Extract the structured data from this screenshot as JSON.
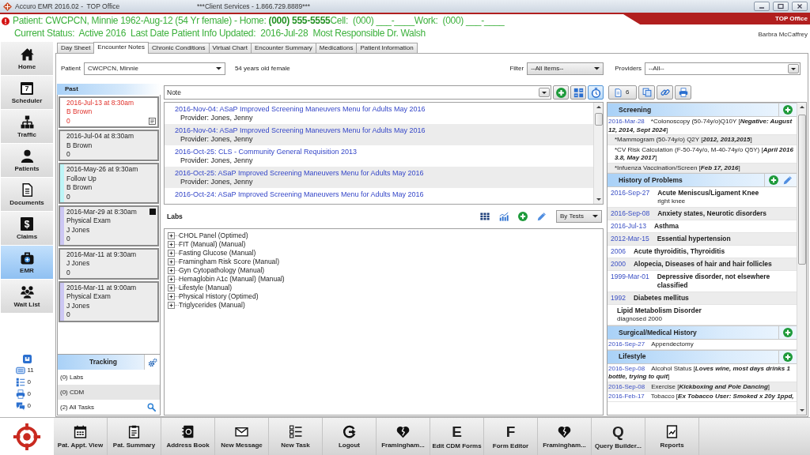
{
  "window": {
    "title": "Accuro EMR 2016.02 -  TOP Office",
    "banner": "***Client Services - 1.866.729.8889***"
  },
  "header": {
    "office": "TOP Office",
    "patient_line": "Patient: CWCPCN, Minnie 1962-Aug-12 (54 Yr female) - Home: **(000) 555-5555**Cell:  (000) ___-____Work:  (000) ___-____",
    "status_line": "Current Status:  Active 2016  Last Date Patient Info Updated:  2016-Jul-28  Most Responsible Dr. Walsh",
    "user": "Barbra McCaffrey"
  },
  "sidebar": {
    "items": [
      {
        "label": "Home",
        "selected": false
      },
      {
        "label": "Scheduler",
        "glyph": "7",
        "selected": false
      },
      {
        "label": "Traffic",
        "selected": false
      },
      {
        "label": "Patients",
        "selected": false
      },
      {
        "label": "Documents",
        "selected": false
      },
      {
        "label": "Claims",
        "glyph": "$",
        "selected": false
      },
      {
        "label": "EMR",
        "selected": true
      },
      {
        "label": "Wait List",
        "selected": false
      }
    ],
    "counters": [
      {
        "count": "11"
      },
      {
        "count": "0"
      },
      {
        "count": "0"
      },
      {
        "count": "0"
      }
    ]
  },
  "tabs": [
    {
      "label": "Day Sheet",
      "selected": false
    },
    {
      "label": "Encounter Notes",
      "selected": true
    },
    {
      "label": "Chronic Conditions",
      "selected": false
    },
    {
      "label": "Virtual Chart",
      "selected": false
    },
    {
      "label": "Encounter Summary",
      "selected": false
    },
    {
      "label": "Medications",
      "selected": false
    },
    {
      "label": "Patient Information",
      "selected": false
    }
  ],
  "patient_bar": {
    "patient_label": "Patient",
    "patient": "CWCPCN, Minnie",
    "summary": "54 years old female",
    "filter_label": "Filter",
    "filter": "--All Items--",
    "providers_label": "Providers",
    "providers": "--All--"
  },
  "past": {
    "title": "Past",
    "items": [
      {
        "datetime": "2016-Jul-13 at 8:30am",
        "provider": "B Brown",
        "count": "0",
        "selected": true,
        "note": true,
        "flag": false
      },
      {
        "datetime": "2016-Jul-04 at 8:30am",
        "provider": "B Brown",
        "count": "0",
        "selected": false,
        "note": false,
        "flag": false
      },
      {
        "datetime": "2016-May-26 at 9:30am",
        "type": "Follow Up",
        "provider": "B Brown",
        "count": "0",
        "color": "#bdf5f7",
        "selected": false,
        "note": false,
        "flag": false
      },
      {
        "datetime": "2016-Mar-29 at 8:30am",
        "type": "Physical Exam",
        "provider": "J Jones",
        "count": "0",
        "color": "#ccc7f3",
        "selected": false,
        "note": false,
        "flag": true
      },
      {
        "datetime": "2016-Mar-11 at 9:30am",
        "provider": "J Jones",
        "count": "0",
        "selected": false,
        "note": false,
        "flag": false
      },
      {
        "datetime": "2016-Mar-11 at 9:00am",
        "type": "Physical Exam",
        "provider": "J Jones",
        "count": "0",
        "color": "#ccc7f3",
        "selected": false,
        "note": false,
        "flag": false
      }
    ]
  },
  "tracking": {
    "title": "Tracking",
    "rows": [
      {
        "text": "(0) Labs"
      },
      {
        "text": "(0) CDM"
      },
      {
        "text": "(2) All Tasks"
      }
    ]
  },
  "notes": {
    "type": "Note",
    "tools": [
      {
        "pressed": false
      },
      {
        "pressed": false
      },
      {
        "pressed": true
      }
    ],
    "items": [
      {
        "title": "2016-Nov-04: ASaP Improved Screening Maneuvers Menu for Adults May 2016",
        "provider": "Provider: Jones, Jenny"
      },
      {
        "title": "2016-Nov-04: ASaP Improved Screening Maneuvers Menu for Adults May 2016",
        "provider": "Provider: Jones, Jenny"
      },
      {
        "title": "2016-Oct-25: CLS - Community General Requisition 2013",
        "provider": "Provider: Jones, Jenny"
      },
      {
        "title": "2016-Oct-25: ASaP Improved Screening Maneuvers Menu for Adults May 2016",
        "provider": "Provider: Jones, Jenny"
      },
      {
        "title": "2016-Oct-24: ASaP Improved Screening Maneuvers Menu for Adults May 2016"
      }
    ]
  },
  "labs": {
    "title": "Labs",
    "view": "By Tests",
    "items": [
      {
        "label": "CHOL Panel (Optimed)",
        "expanded": false
      },
      {
        "label": "FIT (Manual) (Manual)",
        "expanded": false
      },
      {
        "label": "Fasting Glucose (Manual)",
        "expanded": false
      },
      {
        "label": "Framingham Risk Score (Manual)",
        "expanded": false
      },
      {
        "label": "Gyn Cytopathology (Manual)",
        "expanded": false
      },
      {
        "label": "Hemaglobin A1c (Manual) (Manual)",
        "expanded": false
      },
      {
        "label": "Lifestyle (Manual)",
        "expanded": false
      },
      {
        "label": "Physical History (Optimed)",
        "expanded": false
      },
      {
        "label": "Triglycerides (Manual)",
        "expanded": false
      }
    ]
  },
  "summary": {
    "count": "6",
    "sections": [
      {
        "title": "Screening",
        "kind": "entries",
        "editable": false,
        "rows": [
          {
            "date": "2016-Mar-28",
            "parts": [
              {
                "text": "*Colonoscopy (50-74y/o)Q10Y [",
                "bold": false
              },
              {
                "text": "Negative: August 12, 2014, Sept 2024",
                "bold": true
              },
              {
                "text": "]",
                "bold": false
              }
            ]
          },
          {
            "parts": [
              {
                "text": "*Mammogram (50-74y/o) Q2Y [",
                "bold": false
              },
              {
                "text": "2012, 2013,2015",
                "bold": true
              },
              {
                "text": "]",
                "bold": false
              }
            ]
          },
          {
            "parts": [
              {
                "text": "*CV Risk Calculation (F-50-74y/o, M-40-74y/o Q5Y) [",
                "bold": false
              },
              {
                "text": "April 2016 3.8, May 2017",
                "bold": true
              },
              {
                "text": "]",
                "bold": false
              }
            ]
          },
          {
            "parts": [
              {
                "text": "*Infuenza Vaccination/Screen [",
                "bold": false
              },
              {
                "text": "Feb 17, 2016",
                "bold": true
              },
              {
                "text": "]",
                "bold": false
              }
            ]
          }
        ]
      },
      {
        "title": "History of Problems",
        "kind": "problems",
        "editable": true,
        "rows": [
          {
            "date": "2016-Sep-27",
            "title": "Acute Meniscus/Ligament Knee",
            "detail": "right knee"
          },
          {
            "date": "2016-Sep-08",
            "title": "Anxiety states, Neurotic disorders"
          },
          {
            "date": "2016-Jul-13",
            "title": "Asthma"
          },
          {
            "date": "2012-Mar-15",
            "title": "Essential hypertension"
          },
          {
            "date": "2006",
            "title": "Acute thyroiditis, Thyroiditis"
          },
          {
            "date": "2000",
            "title": "Alopecia, Diseases of hair and hair follicles"
          },
          {
            "date": "1999-Mar-01",
            "title": "Depressive disorder, not elsewhere classified"
          },
          {
            "date": "1992",
            "title": "Diabetes mellitus"
          },
          {
            "title": "Lipid Metabolism Disorder",
            "detail": "diagnosed 2000"
          }
        ]
      },
      {
        "title": "Surgical/Medical History",
        "kind": "entries",
        "editable": false,
        "rows": [
          {
            "date": "2016-Sep-27",
            "parts": [
              {
                "text": "Appendectomy",
                "bold": false
              }
            ]
          }
        ]
      },
      {
        "title": "Lifestyle",
        "kind": "entries",
        "editable": false,
        "rows": [
          {
            "date": "2016-Sep-08",
            "parts": [
              {
                "text": "Alcohol Status [",
                "bold": false
              },
              {
                "text": "Loves wine, most days drinks 1 bottle, trying to quit",
                "bold": true
              },
              {
                "text": "]",
                "bold": false
              }
            ]
          },
          {
            "date": "2016-Sep-08",
            "parts": [
              {
                "text": "Exercise [",
                "bold": false
              },
              {
                "text": "Kickboxing and Pole Dancing",
                "bold": true
              },
              {
                "text": "]",
                "bold": false
              }
            ]
          },
          {
            "date": "2016-Feb-17",
            "parts": [
              {
                "text": "Tobacco [",
                "bold": false
              },
              {
                "text": "Ex Tobacco User: Smoked x 20y 1ppd,",
                "bold": true
              }
            ]
          }
        ]
      }
    ]
  },
  "toolbar": {
    "buttons": [
      {
        "label": "Pat. Appt. View"
      },
      {
        "label": "Pat. Summary"
      },
      {
        "label": "Address Book"
      },
      {
        "label": "New Message"
      },
      {
        "label": "New Task"
      },
      {
        "label": "Logout"
      },
      {
        "label": "Framingham..."
      },
      {
        "label": "Edit CDM Forms",
        "glyph": "E"
      },
      {
        "label": "Form Editor",
        "glyph": "F"
      },
      {
        "label": "Framingham..."
      },
      {
        "label": "Query Builder...",
        "glyph": "Q"
      },
      {
        "label": "Reports"
      }
    ]
  }
}
